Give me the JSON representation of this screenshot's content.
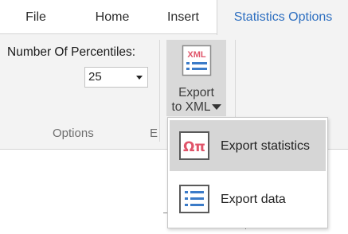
{
  "tabs": [
    {
      "label": "File"
    },
    {
      "label": "Home"
    },
    {
      "label": "Insert"
    },
    {
      "label": "Statistics Options"
    }
  ],
  "options_group": {
    "percentiles_label": "Number Of Percentiles:",
    "percentiles_value": "25",
    "group_label": "Options"
  },
  "export_group": {
    "button_line1": "Export",
    "button_line2": "to XML",
    "icon_badge": "XML",
    "group_label_partial": "E"
  },
  "dropdown_menu": {
    "items": [
      {
        "label": "Export statistics",
        "icon": "omega-pi-icon",
        "icon_text": "Ωπ"
      },
      {
        "label": "Export data",
        "icon": "list-icon"
      }
    ]
  },
  "colors": {
    "accent_tab": "#2e6fc0",
    "xml_badge": "#e0556a",
    "list_blue": "#3b7bc8"
  }
}
